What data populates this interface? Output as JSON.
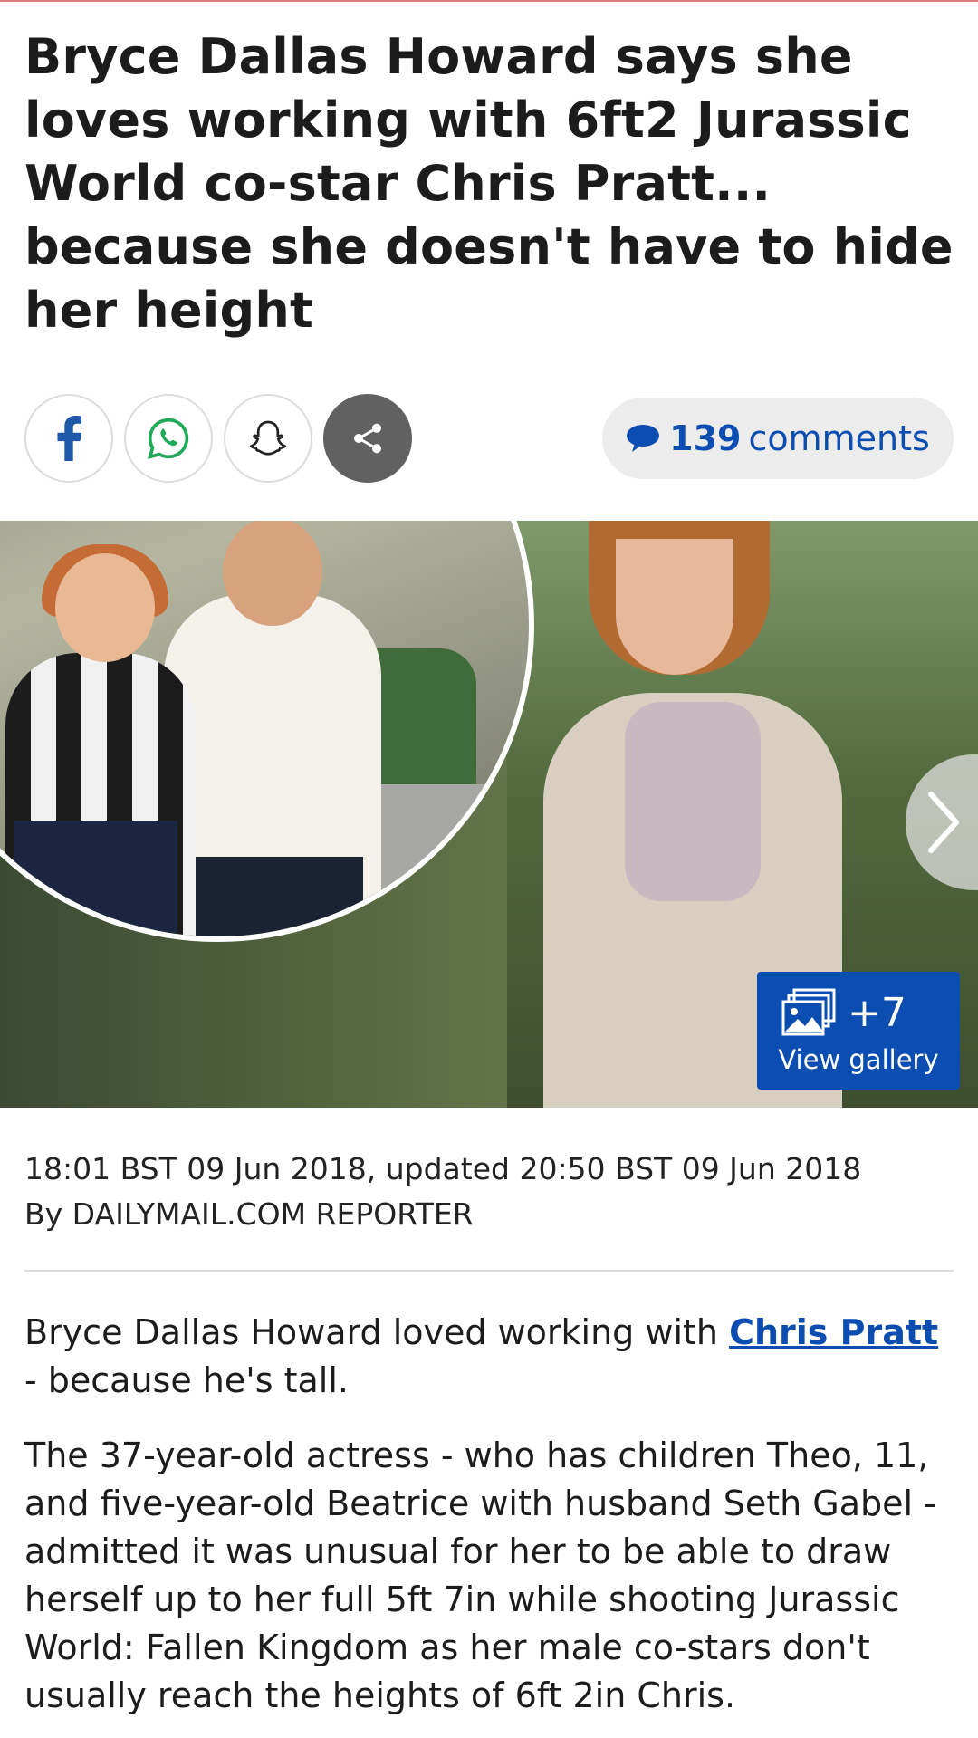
{
  "article": {
    "headline": "Bryce Dallas Howard says she loves working with 6ft2 Jurassic World co-star Chris Pratt... because she doesn't have to hide her height",
    "timestamp": "18:01 BST 09 Jun 2018, updated 20:50 BST 09 Jun 2018",
    "byline": "By DAILYMAIL.COM REPORTER",
    "para1_before": "Bryce Dallas Howard loved working with ",
    "para1_link": "Chris Pratt",
    "para1_after": " - because he's tall.",
    "para2": "The 37-year-old actress - who has children Theo, 11, and five-year-old Beatrice with husband Seth Gabel - admitted it was unusual for her to be able to draw herself up to her full 5ft 7in while shooting Jurassic World: Fallen Kingdom as her male co-stars don't usually reach the heights of 6ft 2in Chris."
  },
  "share": {
    "icons": [
      "facebook-icon",
      "whatsapp-icon",
      "snapchat-icon",
      "share-icon"
    ],
    "comments_count": "139",
    "comments_label": "comments"
  },
  "gallery": {
    "count": "+7",
    "label": "View gallery"
  },
  "colors": {
    "brand_blue": "#0b4db0",
    "share_gray": "#616161",
    "pill_bg": "#ececec"
  }
}
